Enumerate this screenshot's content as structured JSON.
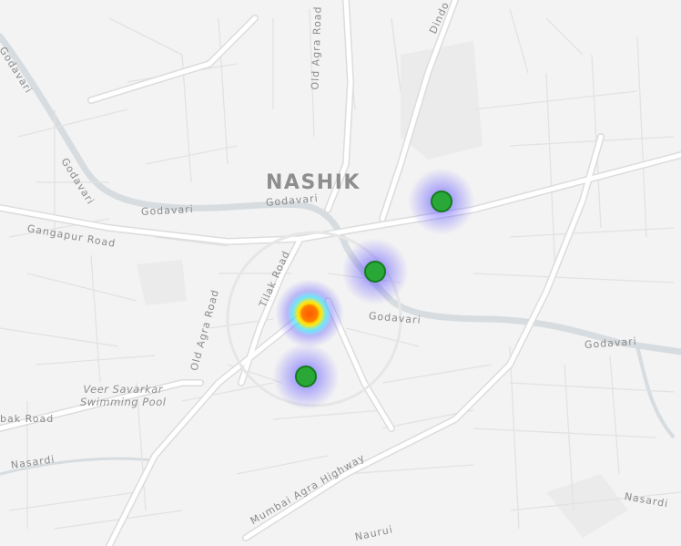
{
  "map": {
    "place_labels": {
      "city": "NASHIK",
      "godavari_nw": "Godavari",
      "godavari_diag": "Godavari",
      "godavari_mid": "Godavari",
      "godavari_centre": "Godavari",
      "godavari_east": "Godavari",
      "godavari_se": "Godavari",
      "gangapur_road": "Gangapur Road",
      "old_agra_road_n": "Old Agra Road",
      "old_agra_road_s": "Old Agra Road",
      "tilak_road": "Tilak Road",
      "dindori_road": "Dindo",
      "trimbak_road": "bak Road",
      "nasardi_w": "Nasardi",
      "nasardi_e": "Nasardi",
      "mumbai_agra_highway": "Mumbai Agra Highway",
      "swimming_pool": "Veer Savarkar\nSwimming Pool",
      "bottom_road": "Naurui"
    },
    "hotspots": [
      {
        "level": "high",
        "color": "#2aa837"
      },
      {
        "level": "high",
        "color": "#2aa837"
      },
      {
        "level": "peak",
        "color": "#ff7a00"
      },
      {
        "level": "high",
        "color": "#2aa837"
      }
    ],
    "colors": {
      "background": "#f3f3f3",
      "road": "#ffffff",
      "road_casing": "#dcdcdc",
      "river": "#d6dce0",
      "label": "#8a8a8a",
      "heat_glow": "#4a3bff"
    }
  }
}
